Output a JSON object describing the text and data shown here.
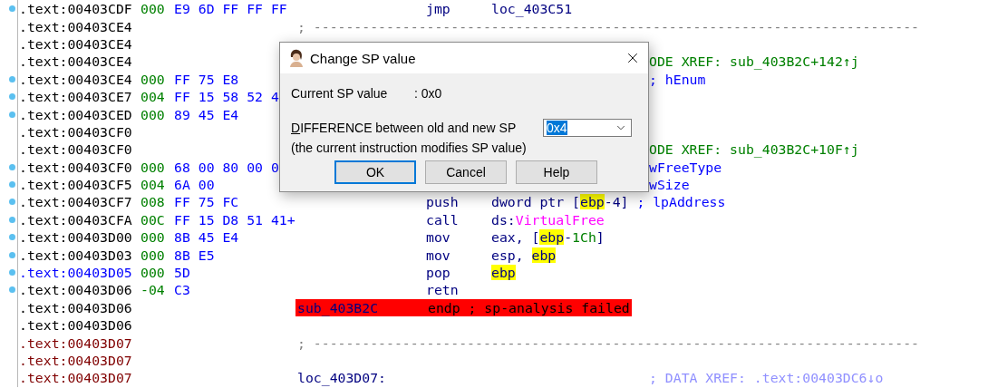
{
  "listing": {
    "rows": [
      {
        "kind": "code",
        "address": ".text:00403CDF",
        "color": "#000000",
        "marked": true,
        "sp": "000",
        "bytes": "E9 6D FF FF FF",
        "mnemonic": "jmp",
        "operand": [
          {
            "text": "loc_403C51",
            "kind": "plain"
          }
        ]
      },
      {
        "kind": "separator",
        "address": ".text:00403CE4",
        "color": "#000000",
        "marked": false,
        "text": "; ---------------------------------------------------------------------------"
      },
      {
        "kind": "code",
        "address": ".text:00403CE4",
        "color": "#000000",
        "marked": false
      },
      {
        "kind": "code",
        "address": ".text:00403CE4",
        "color": "#000000",
        "marked": false,
        "comment": {
          "text": "ODE XREF: sub_403B2C+142↑j",
          "kind": "xref"
        }
      },
      {
        "kind": "code",
        "address": ".text:00403CE4",
        "color": "#000000",
        "marked": true,
        "sp": "000",
        "bytes": "FF 75 E8",
        "comment": {
          "text": "; hEnum",
          "kind": "arg"
        }
      },
      {
        "kind": "code",
        "address": ".text:00403CE7",
        "color": "#000000",
        "marked": true,
        "sp": "004",
        "bytes": "FF 15 58 52 4"
      },
      {
        "kind": "code",
        "address": ".text:00403CED",
        "color": "#000000",
        "marked": true,
        "sp": "000",
        "bytes": "89 45 E4"
      },
      {
        "kind": "code",
        "address": ".text:00403CF0",
        "color": "#000000",
        "marked": false
      },
      {
        "kind": "code",
        "address": ".text:00403CF0",
        "color": "#000000",
        "marked": false,
        "comment": {
          "text": "ODE XREF: sub_403B2C+10F↑j",
          "kind": "xref"
        }
      },
      {
        "kind": "code",
        "address": ".text:00403CF0",
        "color": "#000000",
        "marked": true,
        "sp": "000",
        "bytes": "68 00 80 00 0",
        "comment": {
          "text": "wFreeType",
          "kind": "arg"
        }
      },
      {
        "kind": "code",
        "address": ".text:00403CF5",
        "color": "#000000",
        "marked": true,
        "sp": "004",
        "bytes": "6A 00",
        "comment": {
          "text": "wSize",
          "kind": "arg"
        }
      },
      {
        "kind": "code",
        "address": ".text:00403CF7",
        "color": "#000000",
        "marked": true,
        "sp": "008",
        "bytes": "FF 75 FC",
        "mnemonic": "push",
        "operand": [
          {
            "text": "dword ptr [",
            "kind": "plain"
          },
          {
            "text": "ebp",
            "kind": "highlight"
          },
          {
            "text": "-4]",
            "kind": "plain"
          }
        ],
        "comment": {
          "text": "; lpAddress",
          "kind": "arg"
        }
      },
      {
        "kind": "code",
        "address": ".text:00403CFA",
        "color": "#000000",
        "marked": true,
        "sp": "00C",
        "bytes": "FF 15 D8 51 41+",
        "mnemonic": "call",
        "operand": [
          {
            "text": "ds:",
            "kind": "plain"
          },
          {
            "text": "VirtualFree",
            "kind": "import"
          }
        ]
      },
      {
        "kind": "code",
        "address": ".text:00403D00",
        "color": "#000000",
        "marked": true,
        "sp": "000",
        "bytes": "8B 45 E4",
        "mnemonic": "mov",
        "operand": [
          {
            "text": "eax, [",
            "kind": "plain"
          },
          {
            "text": "ebp",
            "kind": "highlight"
          },
          {
            "text": "-",
            "kind": "plain"
          },
          {
            "text": "1Ch",
            "kind": "number"
          },
          {
            "text": "]",
            "kind": "plain"
          }
        ]
      },
      {
        "kind": "code",
        "address": ".text:00403D03",
        "color": "#000000",
        "marked": true,
        "sp": "000",
        "bytes": "8B E5",
        "mnemonic": "mov",
        "operand": [
          {
            "text": "esp, ",
            "kind": "plain"
          },
          {
            "text": "ebp",
            "kind": "highlight"
          }
        ]
      },
      {
        "kind": "code",
        "address": ".text:00403D05",
        "color": "#0000ff",
        "marked": true,
        "sp": "000",
        "bytes": "5D",
        "mnemonic": "pop",
        "operand": [
          {
            "text": "ebp",
            "kind": "highlight"
          }
        ]
      },
      {
        "kind": "code",
        "address": ".text:00403D06",
        "color": "#000000",
        "marked": true,
        "sp": "-04",
        "bytes": "C3",
        "mnemonic": "retn"
      },
      {
        "kind": "proc-end",
        "address": ".text:00403D06",
        "color": "#000000",
        "marked": false,
        "label": "sub_403B2C",
        "text": "endp ; sp-analysis failed"
      },
      {
        "kind": "code",
        "address": ".text:00403D06",
        "color": "#000000",
        "marked": false
      },
      {
        "kind": "separator",
        "address": ".text:00403D07",
        "color": "#800000",
        "marked": false,
        "text": "; ---------------------------------------------------------------------------"
      },
      {
        "kind": "code",
        "address": ".text:00403D07",
        "color": "#800000",
        "marked": false
      },
      {
        "kind": "code",
        "address": ".text:00403D07",
        "color": "#800000",
        "marked": false,
        "label": "loc_403D07:",
        "comment": {
          "text": "; DATA XREF: .text:00403DC6↓o",
          "kind": "data"
        }
      }
    ]
  },
  "dialog": {
    "title": "Change SP value",
    "current_label": "Current SP value",
    "current_value": ": 0x0",
    "difference_label": "DIFFERENCE between old and new SP",
    "difference_value": "0x4",
    "note": "(the current instruction modifies SP value)",
    "buttons": [
      {
        "label": "OK",
        "default": true
      },
      {
        "label": "Cancel",
        "default": false
      },
      {
        "label": "Help",
        "default": false
      }
    ]
  }
}
